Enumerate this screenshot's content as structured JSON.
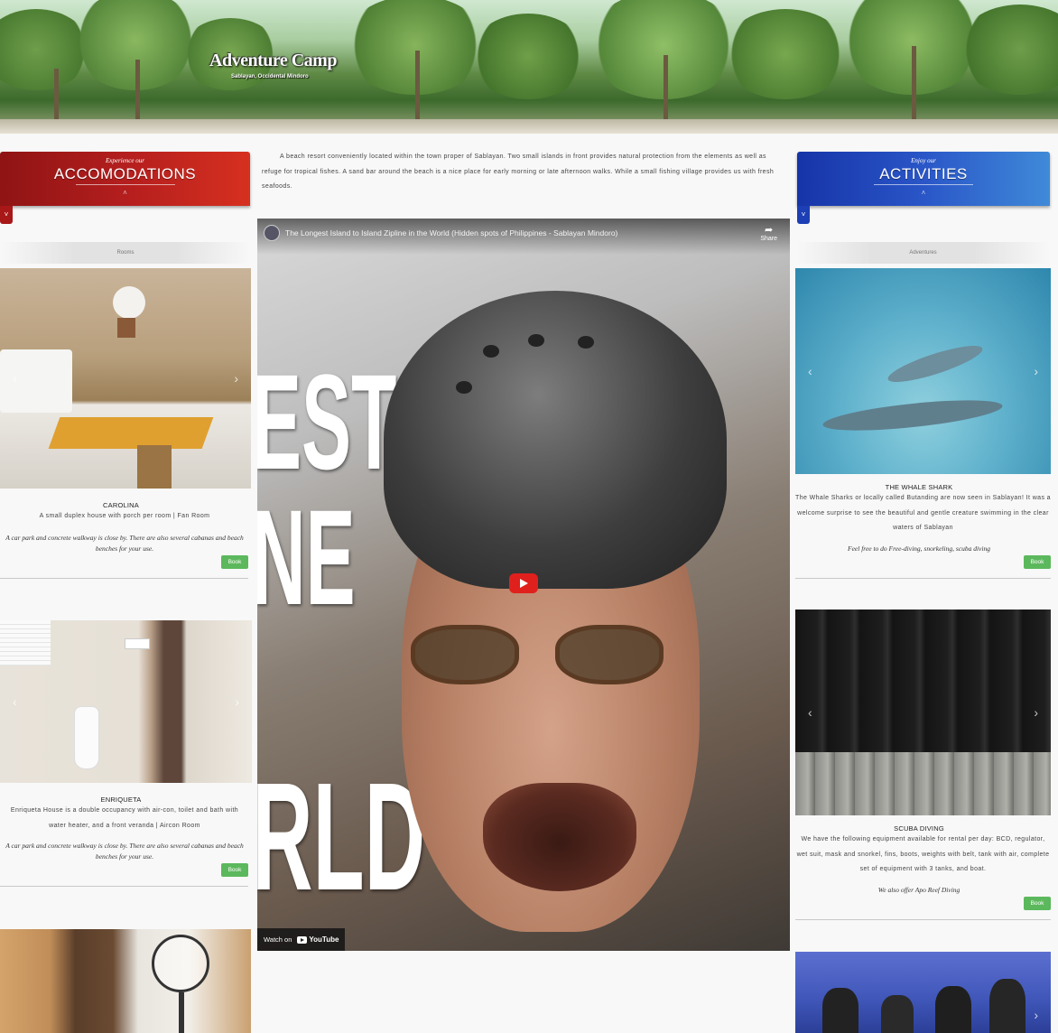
{
  "hero": {
    "title": "Adventure Camp",
    "subtitle": "Sablayan, Occidental Mindoro"
  },
  "accommodations": {
    "pre": "Experience our",
    "title": "ACCOMODATIONS",
    "subtab": "Rooms"
  },
  "activities": {
    "pre": "Enjoy our",
    "title": "ACTIVITIES",
    "subtab": "Adventures"
  },
  "intro": "A beach resort conveniently located within the town proper of Sablayan. Two small islands in front provides natural protection from the elements as well as refuge for tropical fishes. A sand bar around the beach is a nice place for early morning or late afternoon walks. While a small fishing village provides us with fresh seafoods.",
  "video": {
    "title": "The Longest Island to Island Zipline in the World (Hidden spots of Philippines - Sablayan Mindoro)",
    "share": "Share",
    "watch_on": "Watch on",
    "youtube": "YouTube",
    "overlay_lines": [
      "EST",
      "NE",
      "RLD"
    ]
  },
  "rooms": [
    {
      "name": "CAROLINA",
      "desc": "A small duplex house with porch per room | Fan Room",
      "note": "A car park and concrete walkway is close by. There are also several cabanas and beach benches for your use.",
      "button": "Book"
    },
    {
      "name": "ENRIQUETA",
      "desc": "Enriqueta House is a double occupancy with air-con, toilet and bath with water heater, and a front veranda | Aircon Room",
      "note": "A car park and concrete walkway is close by. There are also several cabanas and beach benches for your use.",
      "button": "Book"
    }
  ],
  "adventures": [
    {
      "name": "THE WHALE SHARK",
      "desc": "The Whale Sharks or locally called Butanding are now seen in Sablayan! It was a welcome surprise to see the beautiful and gentle creature swimming in the clear waters of Sablayan",
      "note": "Feel free to do Free-diving, snorkeling, scuba diving",
      "button": "Book"
    },
    {
      "name": "SCUBA DIVING",
      "desc": "We have the following equipment available for rental per day: BCD, regulator, wet suit, mask and snorkel, fins, boots, weights with belt, tank with air, complete set of equipment with 3 tanks, and boat.",
      "note": "We also offer Apo Reef Diving",
      "button": "Book"
    }
  ],
  "icons": {
    "prev": "chevron-left-icon",
    "next": "chevron-right-icon",
    "collapse": "chevron-up-icon",
    "expand": "chevron-down-icon"
  }
}
